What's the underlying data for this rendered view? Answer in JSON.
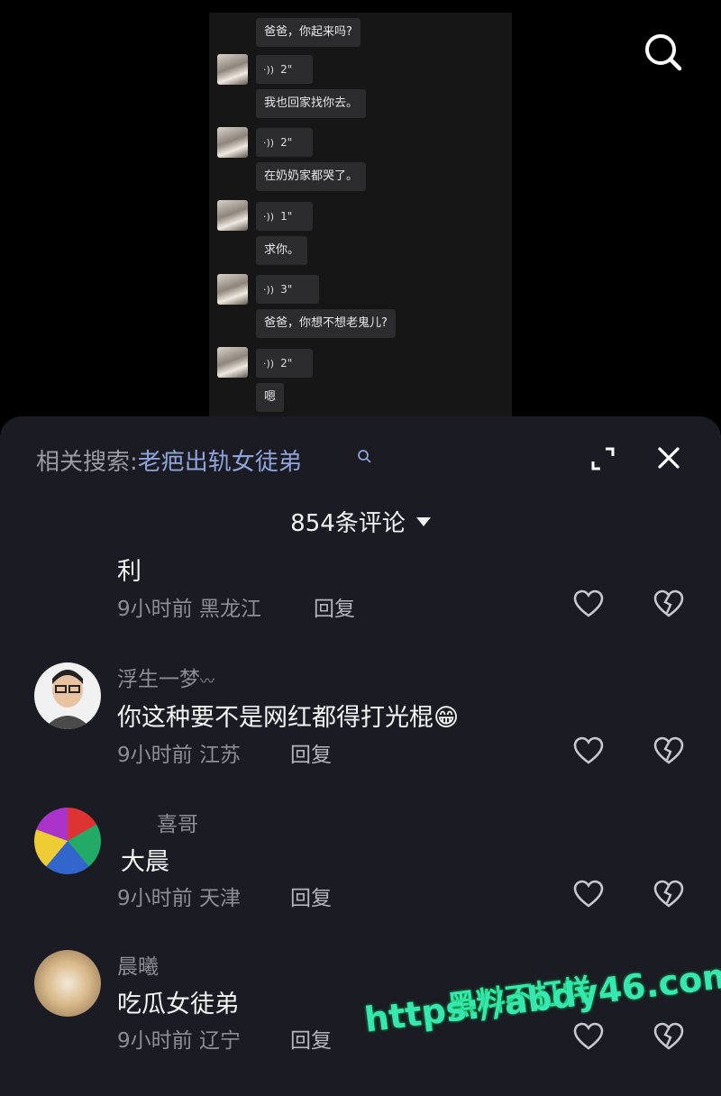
{
  "chat": {
    "messages": [
      {
        "type": "text",
        "text": "爸爸，你起来吗?"
      },
      {
        "type": "voice",
        "duration": "2\""
      },
      {
        "type": "text",
        "text": "我也回家找你去。"
      },
      {
        "type": "voice",
        "duration": "2\""
      },
      {
        "type": "text",
        "text": "在奶奶家都哭了。"
      },
      {
        "type": "voice",
        "duration": "1\""
      },
      {
        "type": "text",
        "text": "求你。"
      },
      {
        "type": "voice",
        "duration": "3\""
      },
      {
        "type": "text",
        "text": "爸爸，你想不想老鬼儿?"
      },
      {
        "type": "voice",
        "duration": "2\""
      },
      {
        "type": "text",
        "text": "嗯"
      }
    ],
    "voice_icon": "·))"
  },
  "panel": {
    "related_label": "相关搜索:",
    "related_term": "老疤出轨女徒弟",
    "comment_count": "854条评论"
  },
  "comments": [
    {
      "user": "",
      "text": "利",
      "time": "9小时前",
      "location": "黑龙江",
      "reply": "回复"
    },
    {
      "user": "浮生一梦",
      "user_suffix": "〰",
      "text": "你这种要不是网红都得打光棍😁",
      "time": "9小时前",
      "location": "江苏",
      "reply": "回复"
    },
    {
      "user": "喜哥",
      "text": "大晨",
      "time": "9小时前",
      "location": "天津",
      "reply": "回复"
    },
    {
      "user": "晨曦",
      "text": "吃瓜女徒弟",
      "time": "9小时前",
      "location": "辽宁",
      "reply": "回复"
    }
  ],
  "watermark": {
    "line1": "黑料不打烊",
    "line2": "https://abdy46.com",
    "color": "#37e6b0"
  }
}
